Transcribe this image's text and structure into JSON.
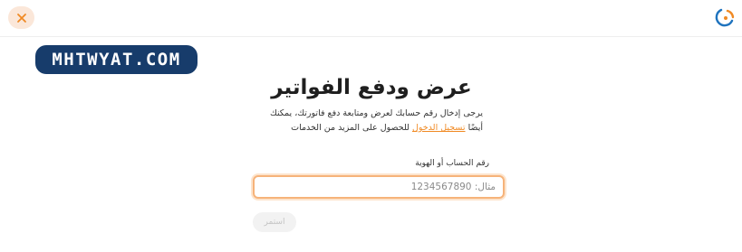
{
  "header": {
    "close_icon": "close-icon",
    "logo_icon": "brand-logo-icon",
    "accent_color": "#f08a24"
  },
  "watermark": {
    "text": "MHTWYAT.COM"
  },
  "main": {
    "title": "عرض ودفع الفواتير",
    "description_line1": "يرجى إدخال رقم حسابك لعرض ومتابعة دفع فاتورتك، يمكنك",
    "description_prefix": "أيضًا",
    "login_link": "تسجيل الدخول",
    "description_suffix": "للحصول على المزيد من الخدمات"
  },
  "form": {
    "field_label": "رقم الحساب أو الهوية",
    "field_value": "",
    "field_placeholder": "مثال: 1234567890",
    "continue_label": "استمر"
  }
}
